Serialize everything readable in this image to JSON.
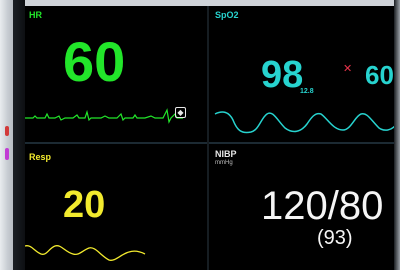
{
  "monitor": {
    "colors": {
      "ecg": "#22e62a",
      "spo2": "#27d3cf",
      "resp": "#f2ea2e",
      "nibp": "#f5f5f5",
      "alarm": "#e8334b",
      "background": "#000000"
    }
  },
  "ecg": {
    "label": "HR",
    "value": "60"
  },
  "spo2": {
    "label": "SpO2",
    "value": "98",
    "pi_value": "12.8",
    "alarm_icon": "x-alarm-off-icon",
    "pulse_rate": "60"
  },
  "resp": {
    "label": "Resp",
    "value": "20"
  },
  "nibp": {
    "label": "NIBP",
    "unit": "mmHg",
    "systolic_diastolic": "120/80",
    "mean": "(93)"
  }
}
